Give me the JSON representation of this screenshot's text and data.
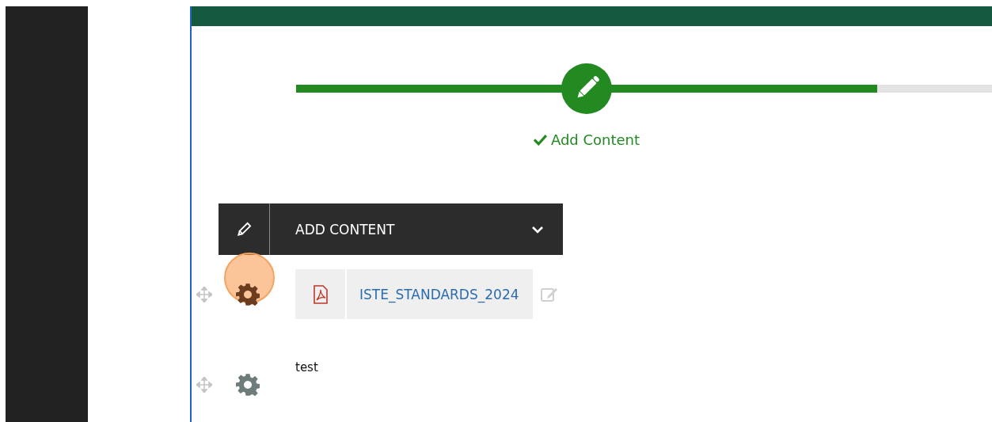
{
  "progress": {
    "level": 0.835,
    "step_label": "Add Content",
    "step_done": true
  },
  "dropdown": {
    "label": "ADD CONTENT",
    "expanded": false
  },
  "items": [
    {
      "kind": "file",
      "name": "ISTE_STANDARDS_2024",
      "highlighted": true
    },
    {
      "kind": "text",
      "text": "test",
      "highlighted": false
    }
  ]
}
